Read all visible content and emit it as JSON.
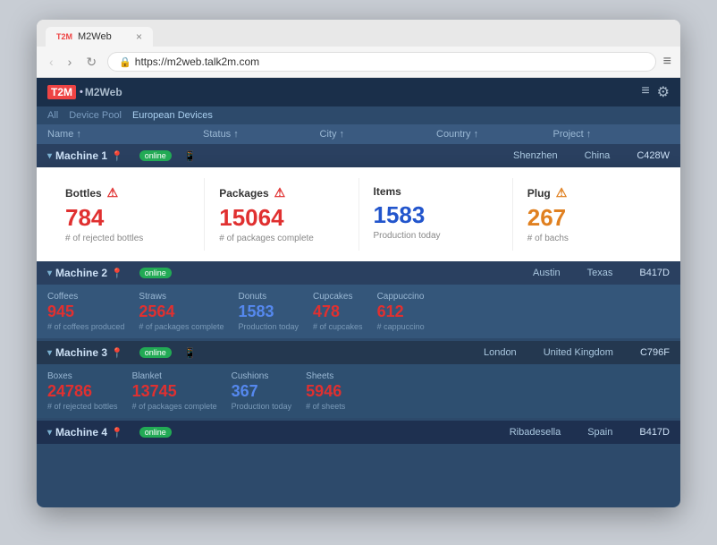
{
  "browser": {
    "tab_favicon": "T2M",
    "tab_title": "M2Web",
    "tab_close": "×",
    "nav_back": "‹",
    "nav_forward": "›",
    "nav_refresh": "↻",
    "address": "https://m2web.talk2m.com",
    "menu_icon": "≡"
  },
  "app": {
    "logo_badge": "T2M",
    "logo_name": "M2Web",
    "settings_icon": "⚙",
    "list_icon": "≡"
  },
  "breadcrumb": {
    "items": [
      "All",
      "Device Pool",
      "European Devices"
    ]
  },
  "table_header": {
    "columns": [
      "Name ↑",
      "Status ↑",
      "City ↑",
      "Country ↑",
      "Project ↑"
    ]
  },
  "machines": [
    {
      "name": "Machine 1",
      "status": "online",
      "city": "Shenzhen",
      "country": "China",
      "project": "C428W",
      "has_white_card": true,
      "cards": [
        {
          "title": "Bottles",
          "alert": "red",
          "value": "784",
          "value_color": "red",
          "subtitle": "# of rejected bottles"
        },
        {
          "title": "Packages",
          "alert": "red",
          "value": "15064",
          "value_color": "red",
          "subtitle": "# of packages complete"
        },
        {
          "title": "Items",
          "alert": "",
          "value": "1583",
          "value_color": "blue",
          "subtitle": "Production today"
        },
        {
          "title": "Plug",
          "alert": "orange",
          "value": "267",
          "value_color": "orange",
          "subtitle": "# of bachs"
        }
      ]
    },
    {
      "name": "Machine 2",
      "status": "online",
      "city": "Austin",
      "country": "Texas",
      "project": "B417D",
      "has_white_card": false,
      "cards": [
        {
          "title": "Coffees",
          "value": "945",
          "value_color": "red",
          "subtitle": "# of coffees produced"
        },
        {
          "title": "Straws",
          "value": "2564",
          "value_color": "red",
          "subtitle": "# of packages complete"
        },
        {
          "title": "Donuts",
          "value": "1583",
          "value_color": "blue",
          "subtitle": "Production today"
        },
        {
          "title": "Cupcakes",
          "value": "478",
          "value_color": "red",
          "subtitle": "# of cupcakes"
        },
        {
          "title": "Cappuccino",
          "value": "612",
          "value_color": "red",
          "subtitle": "# cappuccino"
        }
      ]
    },
    {
      "name": "Machine 3",
      "status": "online",
      "city": "London",
      "country": "United Kingdom",
      "project": "C796F",
      "has_white_card": false,
      "cards": [
        {
          "title": "Boxes",
          "value": "24786",
          "value_color": "red",
          "subtitle": "# of rejected bottles"
        },
        {
          "title": "Blanket",
          "value": "13745",
          "value_color": "red",
          "subtitle": "# of packages complete"
        },
        {
          "title": "Cushions",
          "value": "367",
          "value_color": "blue",
          "subtitle": "Production today"
        },
        {
          "title": "Sheets",
          "value": "5946",
          "value_color": "red",
          "subtitle": "# of sheets"
        }
      ]
    },
    {
      "name": "Machine 4",
      "status": "online",
      "city": "Ribadesella",
      "country": "Spain",
      "project": "B417D",
      "has_white_card": false,
      "cards": []
    }
  ]
}
